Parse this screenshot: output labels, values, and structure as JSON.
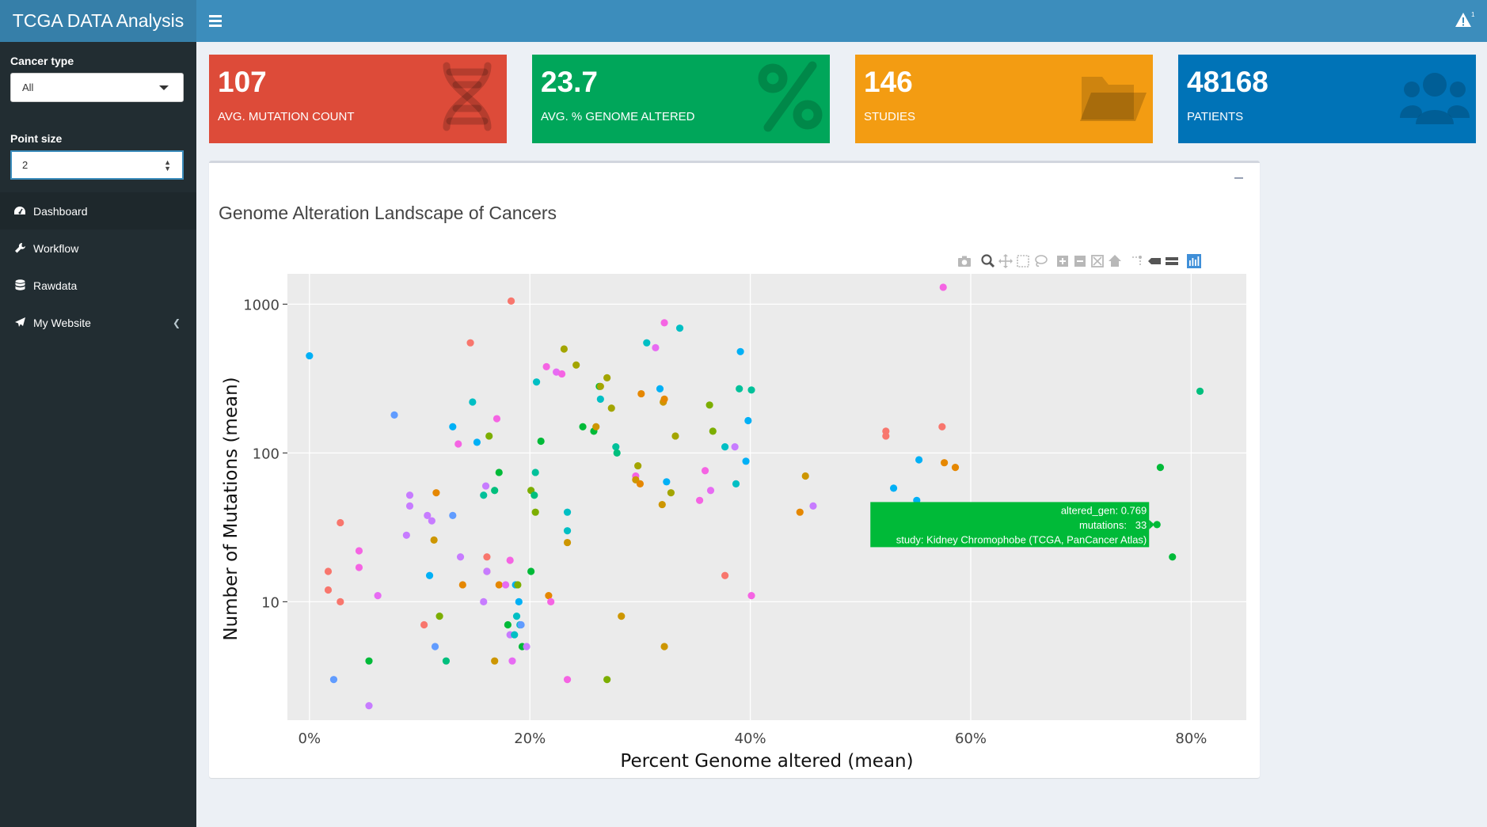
{
  "app": {
    "title": "TCGA DATA Analysis"
  },
  "sidebar": {
    "cancer_type_label": "Cancer type",
    "cancer_type_value": "All",
    "point_size_label": "Point size",
    "point_size_value": "2",
    "menu": [
      {
        "label": "Dashboard",
        "icon": "dashboard-icon"
      },
      {
        "label": "Workflow",
        "icon": "wrench-icon"
      },
      {
        "label": "Rawdata",
        "icon": "database-icon"
      },
      {
        "label": "My Website",
        "icon": "paper-plane-icon"
      }
    ]
  },
  "notifications": {
    "badge": "1"
  },
  "value_boxes": [
    {
      "value": "107",
      "label": "AVG. MUTATION COUNT",
      "color": "#dd4b39",
      "icon": "dna-icon"
    },
    {
      "value": "23.7",
      "label": "AVG. % GENOME ALTERED",
      "color": "#00a65a",
      "icon": "percent-icon"
    },
    {
      "value": "146",
      "label": "STUDIES",
      "color": "#f39c12",
      "icon": "folder-open-icon"
    },
    {
      "value": "48168",
      "label": "PATIENTS",
      "color": "#0073b7",
      "icon": "users-icon"
    }
  ],
  "panel": {
    "title": "Genome Alteration Landscape of Cancers"
  },
  "modebar": [
    "camera-icon",
    "zoom-icon",
    "pan-icon",
    "box-select-icon",
    "lasso-icon",
    "zoom-in-icon",
    "zoom-out-icon",
    "autoscale-icon",
    "reset-axes-icon",
    "spike-lines-icon",
    "hover-closest-icon",
    "hover-compare-icon",
    "plotly-logo-icon"
  ],
  "tooltip": {
    "line1": "altered_gen: 0.769",
    "line2": "mutations:   33",
    "line3": "study: Kidney Chromophobe (TCGA, PanCancer Atlas)",
    "color": "#00ba38"
  },
  "chart_data": {
    "type": "scatter",
    "title": "Genome Alteration Landscape of Cancers",
    "xlabel": "Percent Genome altered (mean)",
    "ylabel": "Number of Mutations (mean)",
    "x_ticks": [
      "0%",
      "20%",
      "40%",
      "60%",
      "80%"
    ],
    "x_tick_values": [
      0,
      0.2,
      0.4,
      0.6,
      0.8
    ],
    "y_ticks": [
      "10",
      "100",
      "1000"
    ],
    "y_tick_values": [
      10,
      100,
      1000
    ],
    "y_scale": "log",
    "xlim": [
      -0.02,
      0.85
    ],
    "ylim": [
      1.6,
      1600
    ],
    "grid": true,
    "points": [
      {
        "x": 0.0,
        "y": 450,
        "c": "#00b0f6"
      },
      {
        "x": 0.017,
        "y": 16,
        "c": "#f8766d"
      },
      {
        "x": 0.017,
        "y": 12,
        "c": "#f8766d"
      },
      {
        "x": 0.022,
        "y": 3,
        "c": "#619cff"
      },
      {
        "x": 0.028,
        "y": 10,
        "c": "#f8766d"
      },
      {
        "x": 0.028,
        "y": 34,
        "c": "#f8766d"
      },
      {
        "x": 0.045,
        "y": 22,
        "c": "#f564e3"
      },
      {
        "x": 0.045,
        "y": 17,
        "c": "#f564e3"
      },
      {
        "x": 0.054,
        "y": 4,
        "c": "#00ba38"
      },
      {
        "x": 0.054,
        "y": 2,
        "c": "#c77cff"
      },
      {
        "x": 0.062,
        "y": 11,
        "c": "#e76bf3"
      },
      {
        "x": 0.077,
        "y": 180,
        "c": "#619cff"
      },
      {
        "x": 0.088,
        "y": 28,
        "c": "#c77cff"
      },
      {
        "x": 0.091,
        "y": 52,
        "c": "#c77cff"
      },
      {
        "x": 0.091,
        "y": 44,
        "c": "#c77cff"
      },
      {
        "x": 0.104,
        "y": 7,
        "c": "#f8766d"
      },
      {
        "x": 0.107,
        "y": 38,
        "c": "#c77cff"
      },
      {
        "x": 0.109,
        "y": 15,
        "c": "#00b0f6"
      },
      {
        "x": 0.111,
        "y": 35,
        "c": "#c77cff"
      },
      {
        "x": 0.113,
        "y": 26,
        "c": "#cd9600"
      },
      {
        "x": 0.115,
        "y": 54,
        "c": "#e58700"
      },
      {
        "x": 0.114,
        "y": 5,
        "c": "#619cff"
      },
      {
        "x": 0.118,
        "y": 8,
        "c": "#7cae00"
      },
      {
        "x": 0.124,
        "y": 4,
        "c": "#00bf7d"
      },
      {
        "x": 0.13,
        "y": 150,
        "c": "#00b0f6"
      },
      {
        "x": 0.13,
        "y": 38,
        "c": "#619cff"
      },
      {
        "x": 0.135,
        "y": 115,
        "c": "#f564e3"
      },
      {
        "x": 0.137,
        "y": 20,
        "c": "#c77cff"
      },
      {
        "x": 0.139,
        "y": 13,
        "c": "#e58700"
      },
      {
        "x": 0.146,
        "y": 550,
        "c": "#f8766d"
      },
      {
        "x": 0.148,
        "y": 220,
        "c": "#00bfc4"
      },
      {
        "x": 0.152,
        "y": 118,
        "c": "#00b0f6"
      },
      {
        "x": 0.158,
        "y": 10,
        "c": "#c77cff"
      },
      {
        "x": 0.158,
        "y": 52,
        "c": "#00c19a"
      },
      {
        "x": 0.16,
        "y": 60,
        "c": "#c77cff"
      },
      {
        "x": 0.161,
        "y": 20,
        "c": "#f8766d"
      },
      {
        "x": 0.161,
        "y": 16,
        "c": "#f8766d"
      },
      {
        "x": 0.161,
        "y": 16,
        "c": "#c77cff"
      },
      {
        "x": 0.163,
        "y": 130,
        "c": "#7cae00"
      },
      {
        "x": 0.168,
        "y": 56,
        "c": "#00bf7d"
      },
      {
        "x": 0.168,
        "y": 4,
        "c": "#cd9600"
      },
      {
        "x": 0.17,
        "y": 170,
        "c": "#f564e3"
      },
      {
        "x": 0.172,
        "y": 74,
        "c": "#00ba38"
      },
      {
        "x": 0.172,
        "y": 13,
        "c": "#e58700"
      },
      {
        "x": 0.178,
        "y": 13,
        "c": "#e76bf3"
      },
      {
        "x": 0.18,
        "y": 7,
        "c": "#00ba38"
      },
      {
        "x": 0.182,
        "y": 19,
        "c": "#f564e3"
      },
      {
        "x": 0.182,
        "y": 6,
        "c": "#c77cff"
      },
      {
        "x": 0.183,
        "y": 1050,
        "c": "#f8766d"
      },
      {
        "x": 0.184,
        "y": 4,
        "c": "#e76bf3"
      },
      {
        "x": 0.186,
        "y": 6,
        "c": "#00bfc4"
      },
      {
        "x": 0.187,
        "y": 13,
        "c": "#00b0f6"
      },
      {
        "x": 0.188,
        "y": 8,
        "c": "#00bfc4"
      },
      {
        "x": 0.189,
        "y": 13,
        "c": "#7cae00"
      },
      {
        "x": 0.19,
        "y": 10,
        "c": "#00b0f6"
      },
      {
        "x": 0.191,
        "y": 7,
        "c": "#00bfc4"
      },
      {
        "x": 0.192,
        "y": 7,
        "c": "#619cff"
      },
      {
        "x": 0.193,
        "y": 5,
        "c": "#00ba38"
      },
      {
        "x": 0.197,
        "y": 5,
        "c": "#c77cff"
      },
      {
        "x": 0.201,
        "y": 56,
        "c": "#7cae00"
      },
      {
        "x": 0.201,
        "y": 16,
        "c": "#00ba38"
      },
      {
        "x": 0.204,
        "y": 52,
        "c": "#00bf7d"
      },
      {
        "x": 0.205,
        "y": 40,
        "c": "#7cae00"
      },
      {
        "x": 0.205,
        "y": 74,
        "c": "#00c19a"
      },
      {
        "x": 0.206,
        "y": 300,
        "c": "#00bfc4"
      },
      {
        "x": 0.21,
        "y": 120,
        "c": "#00ba38"
      },
      {
        "x": 0.215,
        "y": 380,
        "c": "#f564e3"
      },
      {
        "x": 0.217,
        "y": 11,
        "c": "#e58700"
      },
      {
        "x": 0.219,
        "y": 10,
        "c": "#f564e3"
      },
      {
        "x": 0.224,
        "y": 350,
        "c": "#e76bf3"
      },
      {
        "x": 0.229,
        "y": 340,
        "c": "#f564e3"
      },
      {
        "x": 0.231,
        "y": 500,
        "c": "#a3a500"
      },
      {
        "x": 0.234,
        "y": 40,
        "c": "#00bfc4"
      },
      {
        "x": 0.234,
        "y": 30,
        "c": "#00bfc4"
      },
      {
        "x": 0.234,
        "y": 25,
        "c": "#cd9600"
      },
      {
        "x": 0.234,
        "y": 3,
        "c": "#f564e3"
      },
      {
        "x": 0.242,
        "y": 390,
        "c": "#a3a500"
      },
      {
        "x": 0.248,
        "y": 150,
        "c": "#00ba38"
      },
      {
        "x": 0.258,
        "y": 140,
        "c": "#00ba38"
      },
      {
        "x": 0.26,
        "y": 150,
        "c": "#cd9600"
      },
      {
        "x": 0.263,
        "y": 280,
        "c": "#00ba38"
      },
      {
        "x": 0.264,
        "y": 230,
        "c": "#00bfc4"
      },
      {
        "x": 0.264,
        "y": 280,
        "c": "#a3a500"
      },
      {
        "x": 0.27,
        "y": 320,
        "c": "#a3a500"
      },
      {
        "x": 0.27,
        "y": 3,
        "c": "#7cae00"
      },
      {
        "x": 0.274,
        "y": 200,
        "c": "#a3a500"
      },
      {
        "x": 0.278,
        "y": 110,
        "c": "#00c19a"
      },
      {
        "x": 0.279,
        "y": 100,
        "c": "#00bf7d"
      },
      {
        "x": 0.283,
        "y": 8,
        "c": "#cd9600"
      },
      {
        "x": 0.296,
        "y": 70,
        "c": "#f564e3"
      },
      {
        "x": 0.296,
        "y": 66,
        "c": "#cd9600"
      },
      {
        "x": 0.298,
        "y": 82,
        "c": "#a3a500"
      },
      {
        "x": 0.3,
        "y": 62,
        "c": "#e58700"
      },
      {
        "x": 0.301,
        "y": 250,
        "c": "#e58700"
      },
      {
        "x": 0.306,
        "y": 550,
        "c": "#00bfc4"
      },
      {
        "x": 0.314,
        "y": 510,
        "c": "#e76bf3"
      },
      {
        "x": 0.318,
        "y": 270,
        "c": "#00b0f6"
      },
      {
        "x": 0.32,
        "y": 45,
        "c": "#cd9600"
      },
      {
        "x": 0.321,
        "y": 220,
        "c": "#cd9600"
      },
      {
        "x": 0.322,
        "y": 230,
        "c": "#e58700"
      },
      {
        "x": 0.322,
        "y": 5,
        "c": "#cd9600"
      },
      {
        "x": 0.322,
        "y": 750,
        "c": "#f564e3"
      },
      {
        "x": 0.324,
        "y": 64,
        "c": "#00b0f6"
      },
      {
        "x": 0.328,
        "y": 54,
        "c": "#a3a500"
      },
      {
        "x": 0.332,
        "y": 130,
        "c": "#a3a500"
      },
      {
        "x": 0.336,
        "y": 690,
        "c": "#00bfc4"
      },
      {
        "x": 0.354,
        "y": 48,
        "c": "#f564e3"
      },
      {
        "x": 0.359,
        "y": 76,
        "c": "#f564e3"
      },
      {
        "x": 0.363,
        "y": 210,
        "c": "#7cae00"
      },
      {
        "x": 0.364,
        "y": 56,
        "c": "#e76bf3"
      },
      {
        "x": 0.366,
        "y": 140,
        "c": "#7cae00"
      },
      {
        "x": 0.377,
        "y": 15,
        "c": "#f8766d"
      },
      {
        "x": 0.377,
        "y": 110,
        "c": "#00bfc4"
      },
      {
        "x": 0.386,
        "y": 110,
        "c": "#c77cff"
      },
      {
        "x": 0.387,
        "y": 62,
        "c": "#00bfc4"
      },
      {
        "x": 0.39,
        "y": 270,
        "c": "#00c19a"
      },
      {
        "x": 0.391,
        "y": 480,
        "c": "#00b0f6"
      },
      {
        "x": 0.396,
        "y": 88,
        "c": "#00b0f6"
      },
      {
        "x": 0.398,
        "y": 165,
        "c": "#00b0f6"
      },
      {
        "x": 0.401,
        "y": 11,
        "c": "#f564e3"
      },
      {
        "x": 0.401,
        "y": 265,
        "c": "#00c19a"
      },
      {
        "x": 0.445,
        "y": 40,
        "c": "#e58700"
      },
      {
        "x": 0.45,
        "y": 70,
        "c": "#cd9600"
      },
      {
        "x": 0.457,
        "y": 44,
        "c": "#c77cff"
      },
      {
        "x": 0.523,
        "y": 140,
        "c": "#f8766d"
      },
      {
        "x": 0.523,
        "y": 130,
        "c": "#f8766d"
      },
      {
        "x": 0.53,
        "y": 58,
        "c": "#00b0f6"
      },
      {
        "x": 0.551,
        "y": 48,
        "c": "#00b0f6"
      },
      {
        "x": 0.553,
        "y": 90,
        "c": "#00b0f6"
      },
      {
        "x": 0.574,
        "y": 150,
        "c": "#f8766d"
      },
      {
        "x": 0.575,
        "y": 1300,
        "c": "#f564e3"
      },
      {
        "x": 0.576,
        "y": 86,
        "c": "#e58700"
      },
      {
        "x": 0.586,
        "y": 80,
        "c": "#e58700"
      },
      {
        "x": 0.769,
        "y": 33,
        "c": "#00ba38"
      },
      {
        "x": 0.772,
        "y": 80,
        "c": "#00ba38"
      },
      {
        "x": 0.783,
        "y": 20,
        "c": "#00ba38"
      },
      {
        "x": 0.808,
        "y": 260,
        "c": "#00bf7d"
      }
    ],
    "hover_point": {
      "x": 0.769,
      "y": 33
    }
  }
}
